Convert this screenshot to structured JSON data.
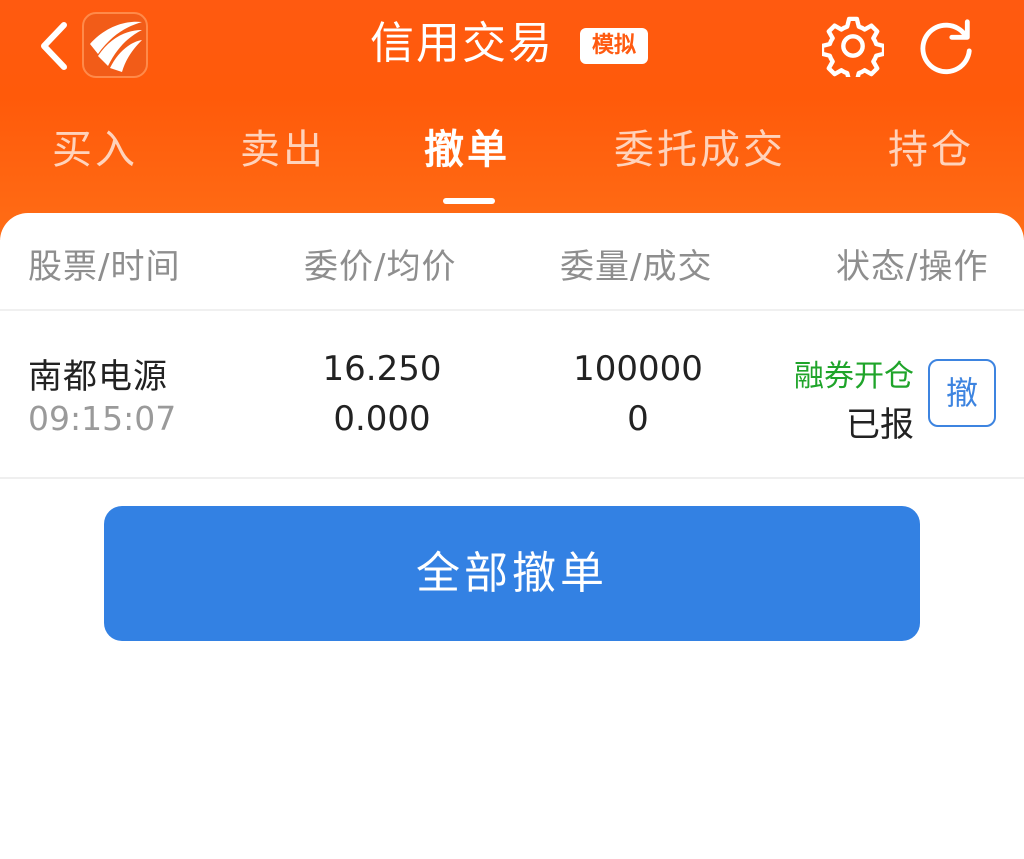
{
  "header": {
    "title": "信用交易",
    "badge": "模拟"
  },
  "tabs": [
    {
      "label": "买入",
      "active": false
    },
    {
      "label": "卖出",
      "active": false
    },
    {
      "label": "撤单",
      "active": true
    },
    {
      "label": "委托成交",
      "active": false
    },
    {
      "label": "持仓",
      "active": false
    }
  ],
  "table": {
    "headers": [
      "股票/时间",
      "委价/均价",
      "委量/成交",
      "状态/操作"
    ],
    "rows": [
      {
        "name": "南都电源",
        "time": "09:15:07",
        "price": "16.250",
        "avg_price": "0.000",
        "qty": "100000",
        "filled": "0",
        "type": "融券开仓",
        "status": "已报",
        "action": "撤"
      }
    ]
  },
  "cancel_all_label": "全部撤单",
  "colors": {
    "brand_orange": "#ff5a10",
    "action_blue": "#3381e3",
    "type_green": "#1fa42a"
  },
  "icons": {
    "back": "chevron-left-icon",
    "logo": "app-logo",
    "settings": "gear-icon",
    "refresh": "refresh-icon"
  }
}
